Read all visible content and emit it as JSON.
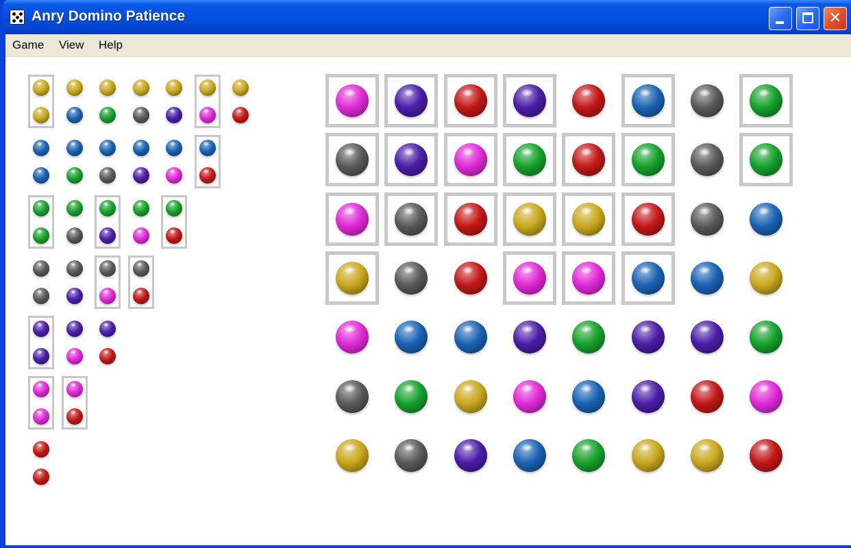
{
  "window": {
    "title": "Anry Domino Patience"
  },
  "menu": [
    {
      "label": "Game"
    },
    {
      "label": "View"
    },
    {
      "label": "Help"
    }
  ],
  "colors": {
    "yellow": "#c9a91e",
    "blue": "#1a63b4",
    "green": "#16a22c",
    "gray": "#5a5a5a",
    "purple": "#4a1ea8",
    "magenta": "#e02ad8",
    "red": "#c31818",
    "frame": "#c8c8c8"
  },
  "tray": {
    "groups": [
      {
        "top": [
          "yellow",
          "yellow",
          "yellow",
          "yellow",
          "yellow",
          "yellow",
          "yellow"
        ],
        "bottom": [
          "yellow",
          "blue",
          "green",
          "gray",
          "purple",
          "magenta",
          "red"
        ],
        "framed": [
          0,
          5
        ]
      },
      {
        "top": [
          "blue",
          "blue",
          "blue",
          "blue",
          "blue",
          "blue"
        ],
        "bottom": [
          "blue",
          "green",
          "gray",
          "purple",
          "magenta",
          "red"
        ],
        "framed": [
          5
        ]
      },
      {
        "top": [
          "green",
          "green",
          "green",
          "green",
          "green"
        ],
        "bottom": [
          "green",
          "gray",
          "purple",
          "magenta",
          "red"
        ],
        "framed": [
          0,
          2,
          4
        ]
      },
      {
        "top": [
          "gray",
          "gray",
          "gray",
          "gray"
        ],
        "bottom": [
          "gray",
          "purple",
          "magenta",
          "red"
        ],
        "framed": [
          2,
          3
        ]
      },
      {
        "top": [
          "purple",
          "purple",
          "purple"
        ],
        "bottom": [
          "purple",
          "magenta",
          "red"
        ],
        "framed": [
          0
        ]
      },
      {
        "top": [
          "magenta",
          "magenta"
        ],
        "bottom": [
          "magenta",
          "red"
        ],
        "framed": [
          0,
          1
        ]
      },
      {
        "top": [
          "red"
        ],
        "bottom": [
          "red"
        ],
        "framed": []
      }
    ]
  },
  "board": {
    "rows": [
      [
        "magenta",
        "purple",
        "red",
        "purple",
        "red",
        "blue",
        "gray",
        "green"
      ],
      [
        "gray",
        "purple",
        "magenta",
        "green",
        "red",
        "green",
        "gray",
        "green"
      ],
      [
        "magenta",
        "gray",
        "red",
        "yellow",
        "yellow",
        "red",
        "gray",
        "blue"
      ],
      [
        "yellow",
        "gray",
        "red",
        "magenta",
        "magenta",
        "blue",
        "blue",
        "yellow"
      ],
      [
        "magenta",
        "blue",
        "blue",
        "purple",
        "green",
        "purple",
        "purple",
        "green"
      ],
      [
        "gray",
        "green",
        "yellow",
        "magenta",
        "blue",
        "purple",
        "red",
        "magenta"
      ],
      [
        "yellow",
        "gray",
        "purple",
        "blue",
        "green",
        "yellow",
        "yellow",
        "red"
      ]
    ],
    "framed": [
      [
        0,
        1,
        2,
        3,
        5,
        7
      ],
      [
        0,
        1,
        2,
        3,
        4,
        5,
        7
      ],
      [
        0,
        1,
        2,
        3,
        4,
        5
      ],
      [
        0,
        3,
        4,
        5
      ],
      [],
      [],
      []
    ]
  }
}
